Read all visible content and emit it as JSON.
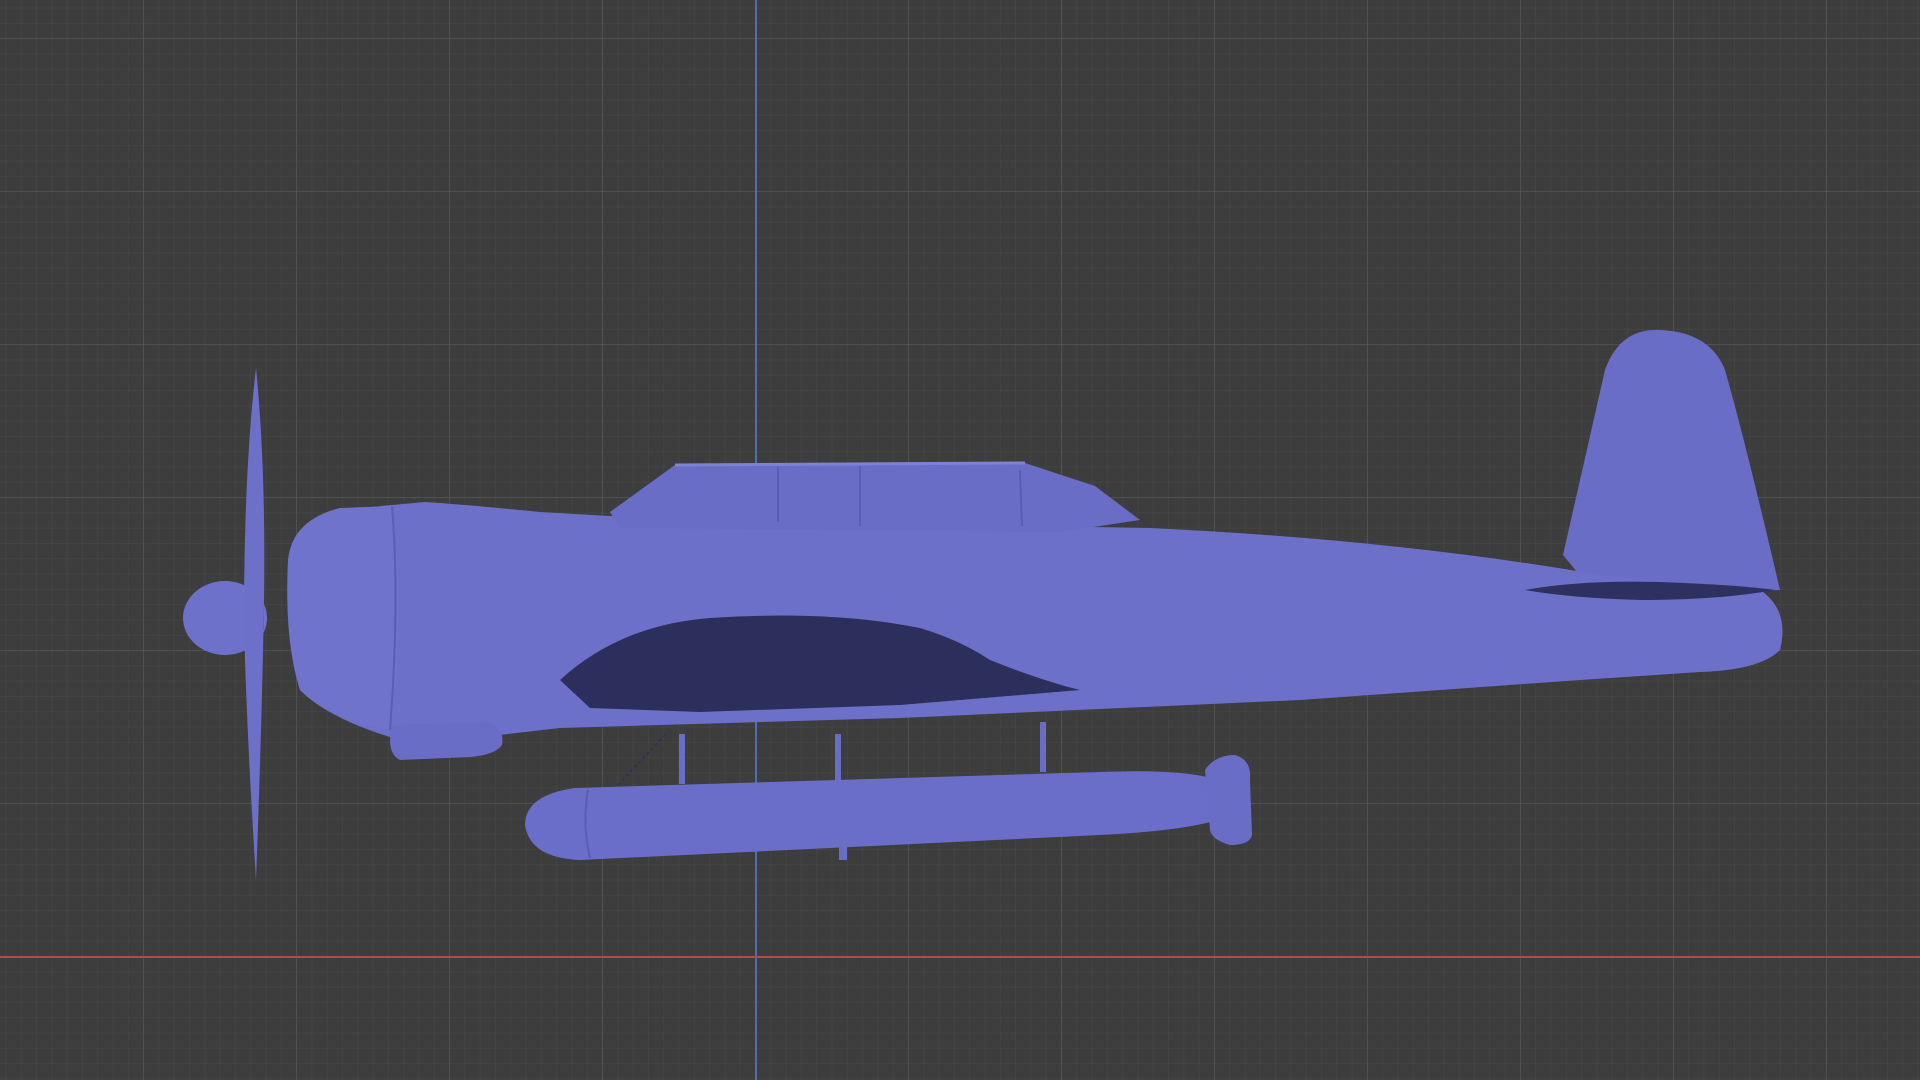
{
  "viewport": {
    "background_color": "#3d3d3d",
    "grid_color": "#555555",
    "axis_z_color": "#4a6fb5",
    "axis_x_color": "#b54a4a"
  },
  "model": {
    "base_color": "#6d70c9",
    "shade_color": "#5a5db5",
    "dark_color": "#2c2e5c",
    "highlight_color": "#7f82d4"
  }
}
